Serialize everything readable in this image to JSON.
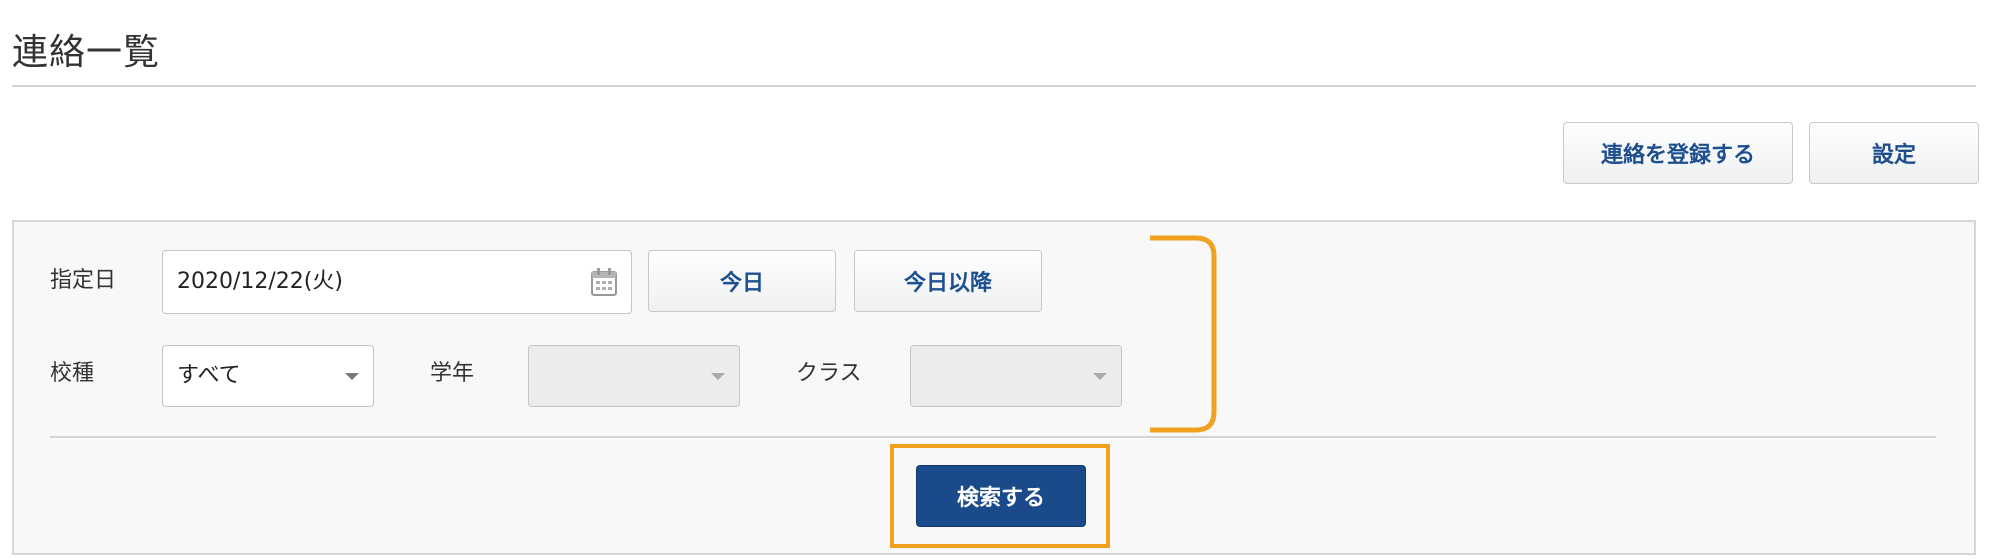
{
  "page": {
    "title": "連絡一覧"
  },
  "actions": {
    "register_label": "連絡を登録する",
    "settings_label": "設定"
  },
  "filters": {
    "date_label": "指定日",
    "date_value": "2020/12/22(火)",
    "today_label": "今日",
    "after_today_label": "今日以降",
    "school_type_label": "校種",
    "school_type_value": "すべて",
    "grade_label": "学年",
    "grade_value": "",
    "class_label": "クラス",
    "class_value": ""
  },
  "search": {
    "button_label": "検索する"
  },
  "colors": {
    "primary_button": "#1b4a8a",
    "link_text": "#1d4e8f",
    "highlight": "#f0a11f"
  }
}
